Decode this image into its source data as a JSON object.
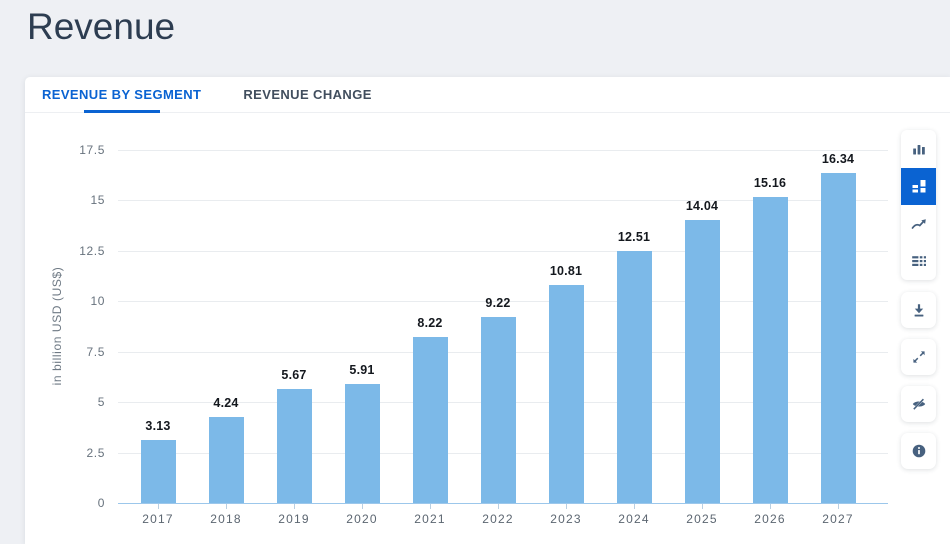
{
  "page": {
    "title": "Revenue"
  },
  "tabs": [
    {
      "label": "REVENUE BY SEGMENT",
      "active": true
    },
    {
      "label": "REVENUE CHANGE",
      "active": false
    }
  ],
  "chart_data": {
    "type": "bar",
    "categories": [
      "2017",
      "2018",
      "2019",
      "2020",
      "2021",
      "2022",
      "2023",
      "2024",
      "2025",
      "2026",
      "2027"
    ],
    "values": [
      3.13,
      4.24,
      5.67,
      5.91,
      8.22,
      9.22,
      10.81,
      12.51,
      14.04,
      15.16,
      16.34
    ],
    "value_labels": [
      "3.13",
      "4.24",
      "5.67",
      "5.91",
      "8.22",
      "9.22",
      "10.81",
      "12.51",
      "14.04",
      "15.16",
      "16.34"
    ],
    "title": "",
    "xlabel": "",
    "ylabel": "in billion USD (US$)",
    "ylim": [
      0,
      17.5
    ],
    "ytick_step": 2.5,
    "yticks": [
      "0",
      "2.5",
      "5",
      "7.5",
      "10",
      "12.5",
      "15",
      "17.5"
    ],
    "grid": true,
    "legend": "none",
    "bar_color": "#7cb9e8"
  },
  "toolbar": {
    "chart_types": [
      {
        "name": "column-chart",
        "active": false
      },
      {
        "name": "segmented-chart",
        "active": true
      },
      {
        "name": "line-chart",
        "active": false
      },
      {
        "name": "data-table",
        "active": false
      }
    ],
    "actions": [
      "download",
      "fullscreen",
      "hide-data",
      "info"
    ]
  },
  "colors": {
    "accent": "#0a63d2",
    "bar": "#7cb9e8",
    "icon": "#47617f"
  }
}
